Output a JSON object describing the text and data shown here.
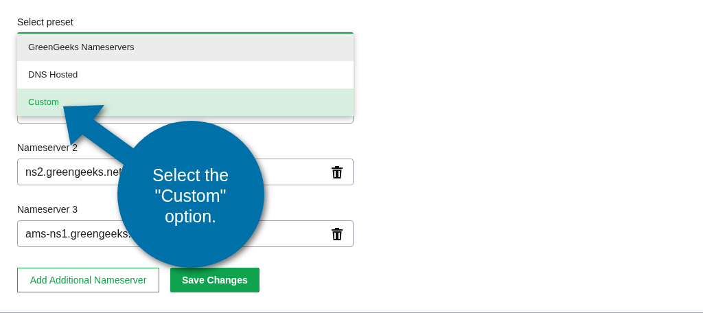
{
  "preset_label": "Select preset",
  "preset_options": [
    {
      "label": "GreenGeeks Nameservers",
      "highlighted": true,
      "selected": false
    },
    {
      "label": "DNS Hosted",
      "highlighted": false,
      "selected": false
    },
    {
      "label": "Custom",
      "highlighted": false,
      "selected": true
    }
  ],
  "nameservers": [
    {
      "label": "Nameserver 2",
      "value": "ns2.greengeeks.net"
    },
    {
      "label": "Nameserver 3",
      "value": "ams-ns1.greengeeks."
    }
  ],
  "buttons": [
    {
      "label": "Add Additional Nameserver",
      "kind": "outline"
    },
    {
      "label": "Save Changes",
      "kind": "primary"
    }
  ],
  "callout": {
    "text": "Select the \"Custom\" option."
  }
}
